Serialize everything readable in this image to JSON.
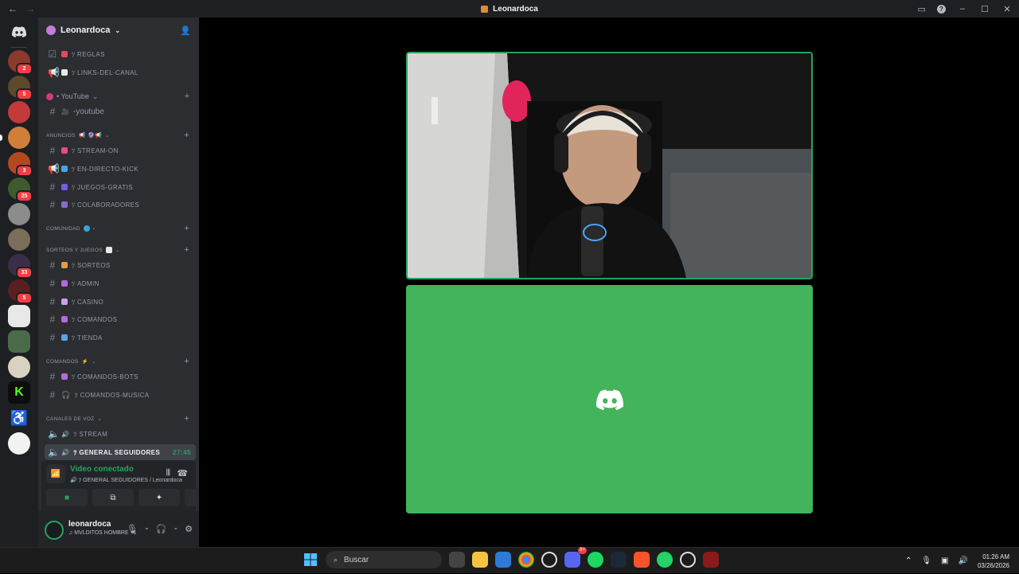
{
  "window": {
    "title": "Leonardoca"
  },
  "server": {
    "name": "Leonardoca"
  },
  "rail": {
    "badges": [
      "2",
      "5",
      "",
      "",
      "3",
      "25",
      "",
      "",
      "33",
      "5",
      "",
      "",
      "",
      "",
      "",
      ""
    ]
  },
  "channels": {
    "top": [
      {
        "label": "ﾂ reglas"
      },
      {
        "label": "ﾂ links-del-canal"
      }
    ],
    "youtube_category": "• YouTube",
    "youtube_channel": "-youtube",
    "anuncios_category": "anuncios",
    "anuncios": [
      {
        "label": "ﾂ stream-on"
      },
      {
        "label": "ﾂ en-directo-kick"
      },
      {
        "label": "ﾂ juegos-gratis"
      },
      {
        "label": "ﾂ colaboradores"
      }
    ],
    "comunidad_category": "comunidad",
    "sorteos_category": "sorteos y juegos",
    "sorteos": [
      {
        "label": "ﾂ sorteos"
      },
      {
        "label": "ﾂ admin"
      },
      {
        "label": "ﾂ casino"
      },
      {
        "label": "ﾂ comandos"
      },
      {
        "label": "ﾂ tienda"
      }
    ],
    "comandos_category": "comandos",
    "comandos": [
      {
        "label": "ﾂ comandos-bots"
      },
      {
        "label": "ﾂ comandos-musica"
      }
    ],
    "voz_category": "canales de voz",
    "voz": [
      {
        "label": "ﾂ stream"
      },
      {
        "label": "ﾂ general seguidores",
        "timer": "27:45"
      }
    ]
  },
  "voice": {
    "title": "Video conectado",
    "subtitle": "ﾂ GENERAL SEGUIDORES / Leonardoca"
  },
  "user": {
    "name": "leonardoca",
    "status": "♫ MVLDITOS HOMBRE +1"
  },
  "taskbar": {
    "search_label": "Buscar",
    "discord_badge": "9+",
    "time": "01:26 AM",
    "date": "03/26/2026"
  },
  "colors": {
    "accent_green": "#23a55a",
    "tile_green": "#43b35c",
    "sidebar": "#2b2d31",
    "rail": "#1e1f22"
  }
}
